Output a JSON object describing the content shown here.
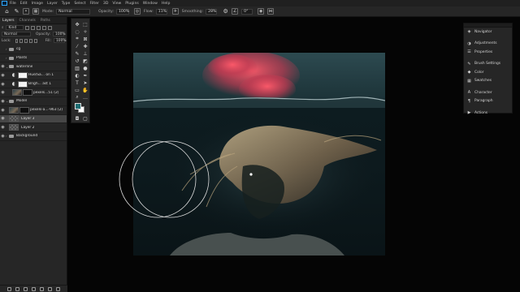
{
  "menubar": {
    "items": [
      "File",
      "Edit",
      "Image",
      "Layer",
      "Type",
      "Select",
      "Filter",
      "3D",
      "View",
      "Plugins",
      "Window",
      "Help"
    ]
  },
  "options": {
    "mode_label": "Mode:",
    "mode_value": "Normal",
    "opacity_label": "Opacity:",
    "opacity_value": "100%",
    "flow_label": "Flow:",
    "flow_value": "11%",
    "smoothing_label": "Smoothing:",
    "smoothing_value": "28%",
    "angle_value": "0°"
  },
  "layers_panel": {
    "tabs": [
      "Layers",
      "Channels",
      "Paths"
    ],
    "kind_label": "Kind",
    "blend_value": "Normal",
    "opacity_label": "Opacity:",
    "opacity_value": "100%",
    "lock_label": "Lock:",
    "fill_label": "Fill:",
    "fill_value": "100%",
    "layers": [
      {
        "name": "cg",
        "type": "folder",
        "visible": false,
        "selected": false
      },
      {
        "name": "Plants",
        "type": "folder",
        "visible": false,
        "selected": false
      },
      {
        "name": "waterline",
        "type": "folder",
        "visible": true,
        "selected": false
      },
      {
        "name": "Hue/Sa... on 1",
        "type": "adjustment",
        "visible": true,
        "selected": false
      },
      {
        "name": "Brigh... ast 1",
        "type": "adjustment",
        "visible": true,
        "selected": false
      },
      {
        "name": "pexels...51 (2)",
        "type": "photo",
        "visible": true,
        "selected": false
      },
      {
        "name": "Model",
        "type": "folder",
        "visible": true,
        "selected": false
      },
      {
        "name": "pexels-a...-963 (2)",
        "type": "photo",
        "visible": true,
        "selected": false
      },
      {
        "name": "Layer 3",
        "type": "layer",
        "visible": true,
        "selected": true
      },
      {
        "name": "Layer 2",
        "type": "layer",
        "visible": true,
        "selected": false
      },
      {
        "name": "Background",
        "type": "layer",
        "visible": true,
        "selected": false
      }
    ]
  },
  "right_panel": {
    "items": [
      {
        "label": "Navigator",
        "icon": "navigator-icon"
      },
      {
        "label": "Adjustments",
        "icon": "adjustments-icon"
      },
      {
        "label": "Properties",
        "icon": "properties-icon"
      },
      {
        "label": "Brush Settings",
        "icon": "brush-settings-icon"
      },
      {
        "label": "Color",
        "icon": "color-icon"
      },
      {
        "label": "Swatches",
        "icon": "swatches-icon"
      },
      {
        "label": "Character",
        "icon": "character-icon"
      },
      {
        "label": "Paragraph",
        "icon": "paragraph-icon"
      },
      {
        "label": "Actions",
        "icon": "actions-icon"
      }
    ]
  },
  "colors": {
    "foreground": "#1e6d72",
    "background": "#ffffff",
    "accent": "#31a8ff"
  }
}
